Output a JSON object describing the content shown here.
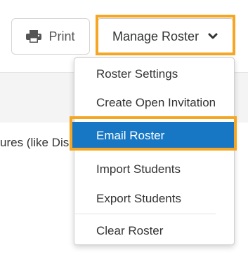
{
  "toolbar": {
    "print_label": "Print",
    "manage_label": "Manage Roster",
    "print_icon": "printer-icon",
    "manage_icon": "chevron-down-icon"
  },
  "background": {
    "text_fragment": "ures (like Dis"
  },
  "menu": {
    "items": [
      {
        "label": "Roster Settings"
      },
      {
        "label": "Create Open Invitation"
      },
      {
        "label": "Email Roster"
      },
      {
        "label": "Import Students"
      },
      {
        "label": "Export Students"
      },
      {
        "label": "Clear Roster"
      }
    ]
  },
  "colors": {
    "highlight": "#f5a623",
    "active_item": "#1777c4"
  }
}
